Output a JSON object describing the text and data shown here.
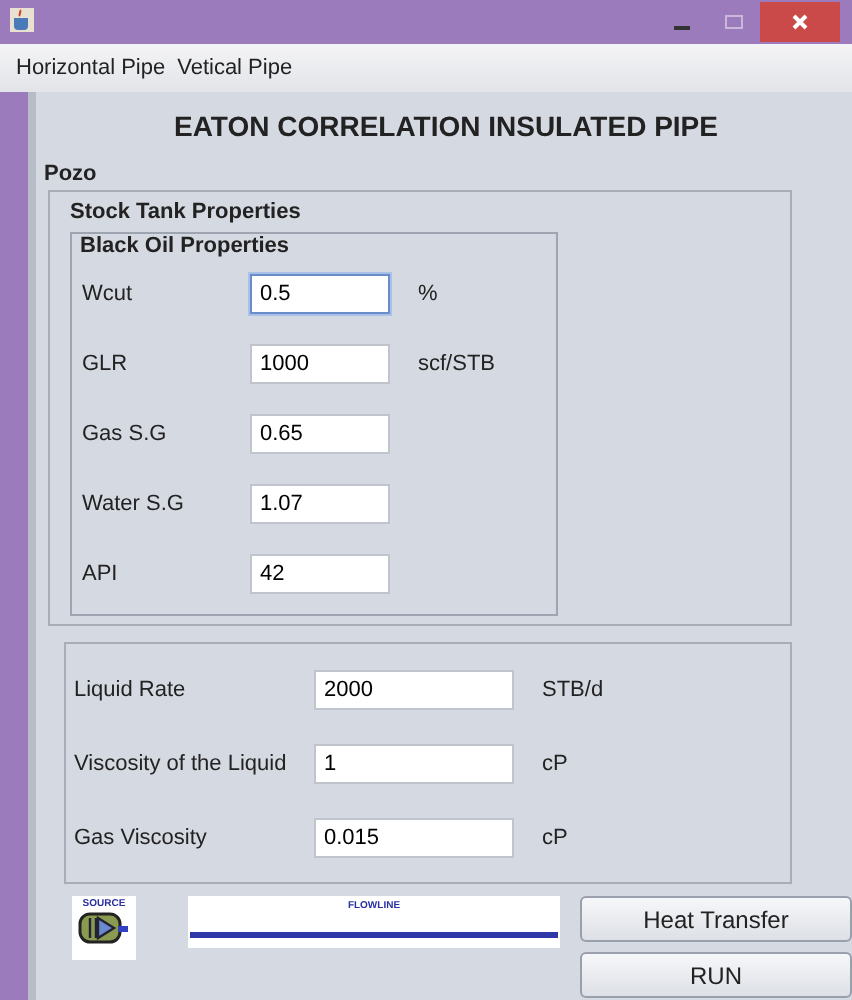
{
  "menu": [
    "Horizontal Pipe",
    "Vetical Pipe"
  ],
  "heading": "EATON CORRELATION INSULATED PIPE",
  "section_label": "Pozo",
  "stock_tank": {
    "title": "Stock Tank Properties",
    "black_oil": {
      "title": "Black Oil Properties",
      "fields": [
        {
          "label": "Wcut",
          "value": "0.5",
          "unit": "%",
          "focused": true
        },
        {
          "label": "GLR",
          "value": "1000",
          "unit": "scf/STB",
          "focused": false
        },
        {
          "label": "Gas S.G",
          "value": "0.65",
          "focused": false
        },
        {
          "label": "Water S.G",
          "value": "1.07",
          "focused": false
        },
        {
          "label": "API",
          "value": "42",
          "focused": false
        }
      ]
    }
  },
  "liquid": {
    "fields": [
      {
        "label": "Liquid Rate",
        "value": "2000",
        "unit": "STB/d"
      },
      {
        "label": "Viscosity of the Liquid",
        "value": "1",
        "unit": "cP"
      },
      {
        "label": "Gas Viscosity",
        "value": "0.015",
        "unit": "cP"
      }
    ]
  },
  "diagram": {
    "source_label": "SOURCE",
    "flowline_label": "FLOWLINE"
  },
  "buttons": [
    "Heat Transfer",
    "RUN"
  ]
}
